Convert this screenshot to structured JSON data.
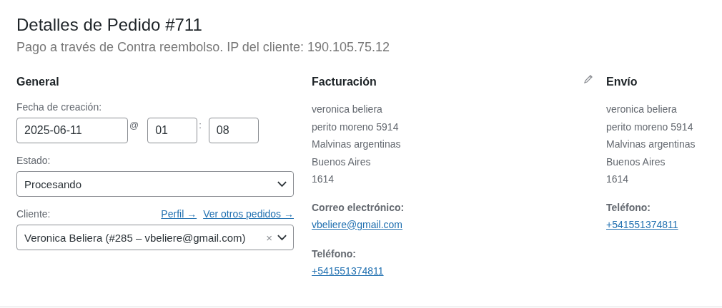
{
  "header": {
    "title": "Detalles de Pedido #711",
    "subtitle": "Pago a través de Contra reembolso. IP del cliente: 190.105.75.12"
  },
  "general": {
    "heading": "General",
    "date_label": "Fecha de creación:",
    "date": "2025-06-11",
    "at": "@",
    "hour": "01",
    "colon": ":",
    "minute": "08",
    "status_label": "Estado:",
    "status": "Procesando",
    "customer_label": "Cliente:",
    "profile_link": "Perfil →",
    "orders_link": "Ver otros pedidos →",
    "customer": "Veronica Beliera (#285 – vbeliere@gmail.com)",
    "clear": "×"
  },
  "billing": {
    "heading": "Facturación",
    "editable": true,
    "address": [
      "veronica beliera",
      "perito moreno 5914",
      "Malvinas argentinas",
      "Buenos Aires",
      "1614"
    ],
    "fields": [
      {
        "label": "Correo electrónico:",
        "value": "vbeliere@gmail.com"
      },
      {
        "label": "Teléfono:",
        "value": "+541551374811"
      }
    ]
  },
  "shipping": {
    "heading": "Envío",
    "address": [
      "veronica beliera",
      "perito moreno 5914",
      "Malvinas argentinas",
      "Buenos Aires",
      "1614"
    ],
    "fields": [
      {
        "label": "Teléfono:",
        "value": "+541551374811"
      }
    ]
  }
}
